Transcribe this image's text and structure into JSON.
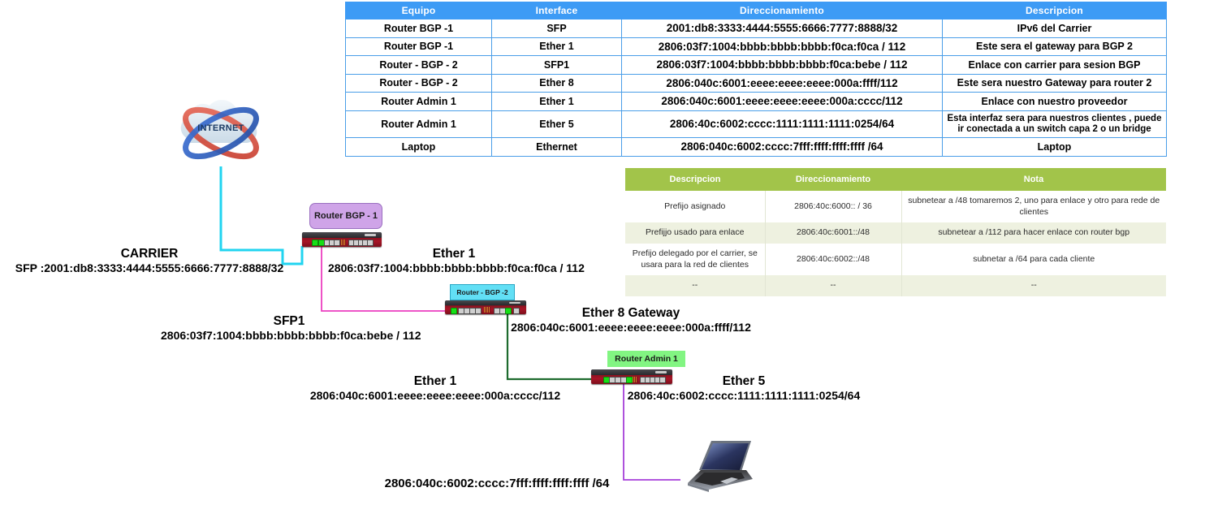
{
  "addressing_table": {
    "headers": [
      "Equipo",
      "Interface",
      "Direccionamiento",
      "Descripcion"
    ],
    "rows": [
      {
        "equipo": "Router BGP -1",
        "interface": "SFP",
        "direccionamiento": "2001:db8:3333:4444:5555:6666:7777:8888/32",
        "descripcion": "IPv6 del Carrier"
      },
      {
        "equipo": "Router BGP -1",
        "interface": "Ether 1",
        "direccionamiento": "2806:03f7:1004:bbbb:bbbb:bbbb:f0ca:f0ca / 112",
        "descripcion": "Este sera el gateway para BGP 2"
      },
      {
        "equipo": "Router - BGP - 2",
        "interface": "SFP1",
        "direccionamiento": "2806:03f7:1004:bbbb:bbbb:bbbb:f0ca:bebe / 112",
        "descripcion": "Enlace con carrier para sesion BGP"
      },
      {
        "equipo": "Router - BGP - 2",
        "interface": "Ether 8",
        "direccionamiento": "2806:040c:6001:eeee:eeee:eeee:000a:ffff/112",
        "descripcion": "Este sera nuestro Gateway para router 2"
      },
      {
        "equipo": "Router Admin 1",
        "interface": "Ether 1",
        "direccionamiento": "2806:040c:6001:eeee:eeee:eeee:000a:cccc/112",
        "descripcion": "Enlace con nuestro proveedor"
      },
      {
        "equipo": "Router Admin 1",
        "interface": "Ether 5",
        "direccionamiento": "2806:40c:6002:cccc:1111:1111:1111:0254/64",
        "descripcion": "Esta interfaz sera para nuestros clientes , puede ir conectada a un switch capa 2 o un bridge"
      },
      {
        "equipo": "Laptop",
        "interface": "Ethernet",
        "direccionamiento": "2806:040c:6002:cccc:7fff:ffff:ffff:ffff /64",
        "descripcion": "Laptop"
      }
    ]
  },
  "prefix_table": {
    "headers": [
      "Descripcion",
      "Direccionamiento",
      "Nota"
    ],
    "rows": [
      {
        "descripcion": "Prefijo asignado",
        "direccionamiento": "2806:40c:6000:: / 36",
        "nota": "subnetear a /48  tomaremos 2, uno para enlace y otro para rede de clientes"
      },
      {
        "descripcion": "Prefijjo usado para enlace",
        "direccionamiento": "2806:40c:6001::/48",
        "nota": "subnetear a /112 para hacer enlace con router bgp"
      },
      {
        "descripcion": "Prefijo delegado por el carrier, se usara para la red de clientes",
        "direccionamiento": "2806:40c:6002::/48",
        "nota": "subnetar a /64 para cada cliente"
      },
      {
        "descripcion": "--",
        "direccionamiento": "--",
        "nota": "--"
      }
    ]
  },
  "diagram": {
    "cloud_label": "INTERNET",
    "nodes": {
      "bgp1": "Router BGP - 1",
      "bgp2": "Router - BGP -2",
      "admin1": "Router Admin 1"
    },
    "labels": {
      "carrier": {
        "line1": "CARRIER",
        "line2": "SFP :2001:db8:3333:4444:5555:6666:7777:8888/32"
      },
      "ether1_bgp1": {
        "line1": "Ether 1",
        "line2": "2806:03f7:1004:bbbb:bbbb:bbbb:f0ca:f0ca / 112"
      },
      "sfp1_bgp2": {
        "line1": "SFP1",
        "line2": "2806:03f7:1004:bbbb:bbbb:bbbb:f0ca:bebe / 112"
      },
      "ether8_gateway": {
        "line1": "Ether 8 Gateway",
        "line2": "2806:040c:6001:eeee:eeee:eeee:000a:ffff/112"
      },
      "ether1_admin": {
        "line1": "Ether 1",
        "line2": "2806:040c:6001:eeee:eeee:eeee:000a:cccc/112"
      },
      "ether5_admin": {
        "line1": "Ether 5",
        "line2": "2806:40c:6002:cccc:1111:1111:1111:0254/64"
      },
      "laptop_addr": {
        "line1": "",
        "line2": "2806:040c:6002:cccc:7fff:ffff:ffff:ffff /64"
      }
    },
    "link_colors": {
      "carrier": "#21d4f0",
      "bgp1_to_bgp2": "#ec3fc0",
      "bgp2_to_admin": "#1e6b2e",
      "admin_to_laptop": "#a63fd9"
    }
  },
  "colors": {
    "blue_header": "#3d9bf5",
    "green_header": "#a2c44a",
    "chip_bgp1": "#cfa4e8",
    "chip_bgp2": "#62dff5",
    "chip_admin": "#82f582"
  }
}
